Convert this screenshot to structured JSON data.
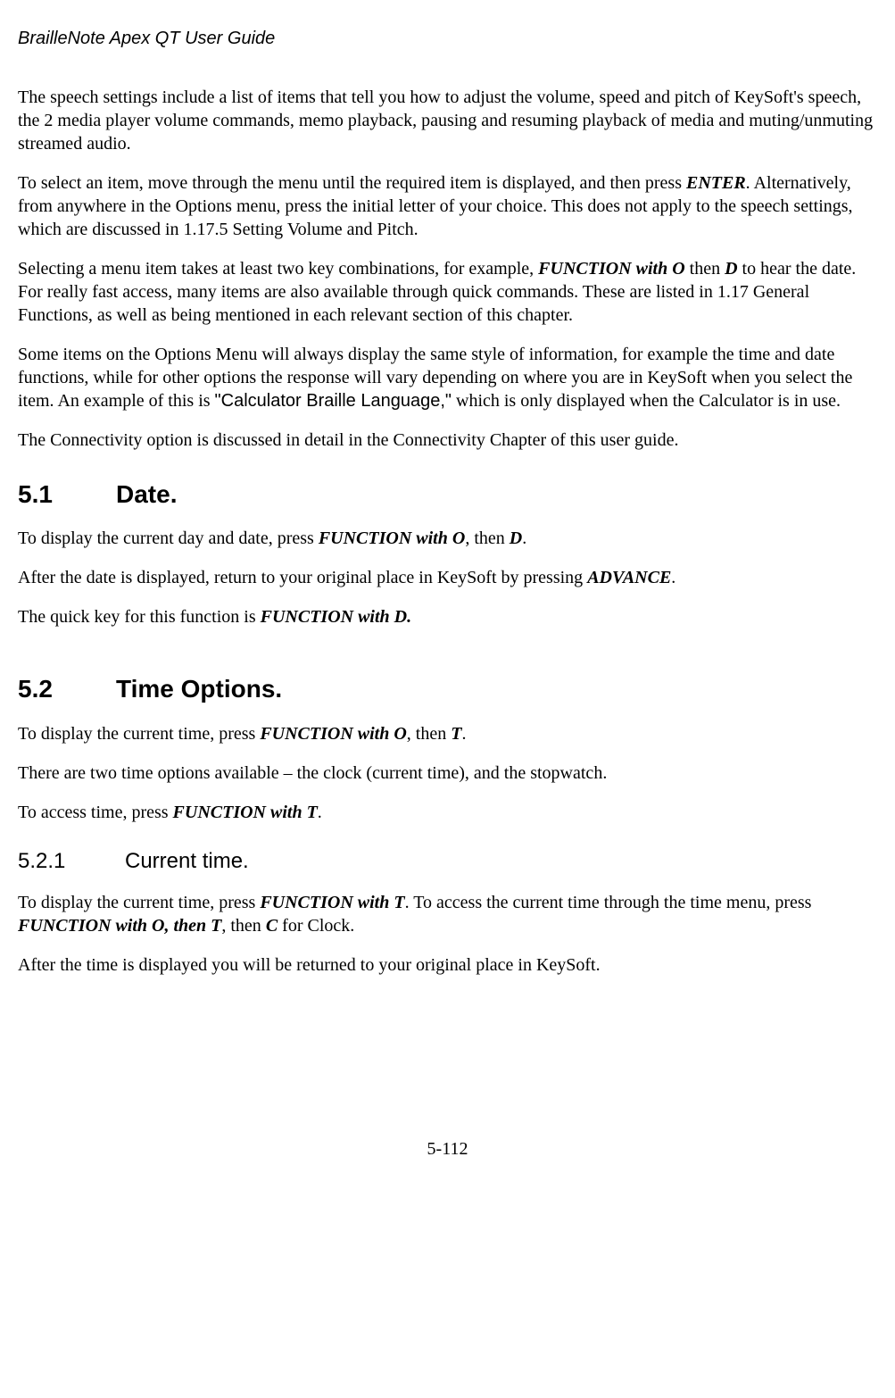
{
  "header": {
    "title": "BrailleNote Apex QT User Guide"
  },
  "intro": {
    "p1": "The speech settings include a list of items that tell you how to adjust the volume, speed and pitch of KeySoft's speech, the 2 media player volume commands, memo playback, pausing and resuming playback of media and muting/unmuting streamed audio.",
    "p2a": "To select an item, move through the menu until the required item is displayed, and then press ",
    "p2_key": "ENTER",
    "p2b": ". Alternatively, from anywhere in the Options menu, press the initial letter of your choice. This does not apply to the speech settings, which are discussed in 1.17.5 Setting Volume and Pitch.",
    "p3a": "Selecting a menu item takes at least two key combinations, for example, ",
    "p3_key1": "FUNCTION with O",
    "p3b": " then ",
    "p3_key2": "D",
    "p3c": " to hear the date. For really fast access, many items are also available through quick commands. These are listed in 1.17 General Functions, as well as being mentioned in each relevant section of this chapter.",
    "p4a": "Some items on the Options Menu will always display the same style of information, for example the time and date functions, while for other options the response will vary depending on where you are in KeySoft when you select the item. An example of this is ",
    "p4_quote": "\"Calculator Braille Language,\"",
    "p4b": " which is only displayed when the Calculator is in use.",
    "p5": "The Connectivity option is discussed in detail in the Connectivity Chapter of this user guide."
  },
  "s51": {
    "num": "5.1",
    "title": "Date.",
    "p1a": "To display the current day and date, press ",
    "p1_key1": "FUNCTION with O",
    "p1b": ", then ",
    "p1_key2": "D",
    "p1c": ".",
    "p2a": "After the date is displayed, return to your original place in KeySoft by pressing ",
    "p2_key": "ADVANCE",
    "p2b": ".",
    "p3a": "The quick key for this function is ",
    "p3_key": "FUNCTION with D."
  },
  "s52": {
    "num": "5.2",
    "title": "Time Options.",
    "p1a": "To display the current time, press ",
    "p1_key1": "FUNCTION with O",
    "p1b": ", then ",
    "p1_key2": "T",
    "p1c": ".",
    "p2": "There are two time options available – the clock (current time), and the stopwatch.",
    "p3a": "To access time, press ",
    "p3_key": "FUNCTION with T",
    "p3b": "."
  },
  "s521": {
    "num": "5.2.1",
    "title": "Current time.",
    "p1a": "To display the current time, press ",
    "p1_key1": "FUNCTION with T",
    "p1b": ". To access the current time through the time menu, press ",
    "p1_key2": "FUNCTION with O, then T",
    "p1c": ", then ",
    "p1_key3": "C",
    "p1d": " for Clock.",
    "p2": "After the time is displayed you will be returned to your original place in KeySoft."
  },
  "footer": {
    "page": "5-112"
  }
}
